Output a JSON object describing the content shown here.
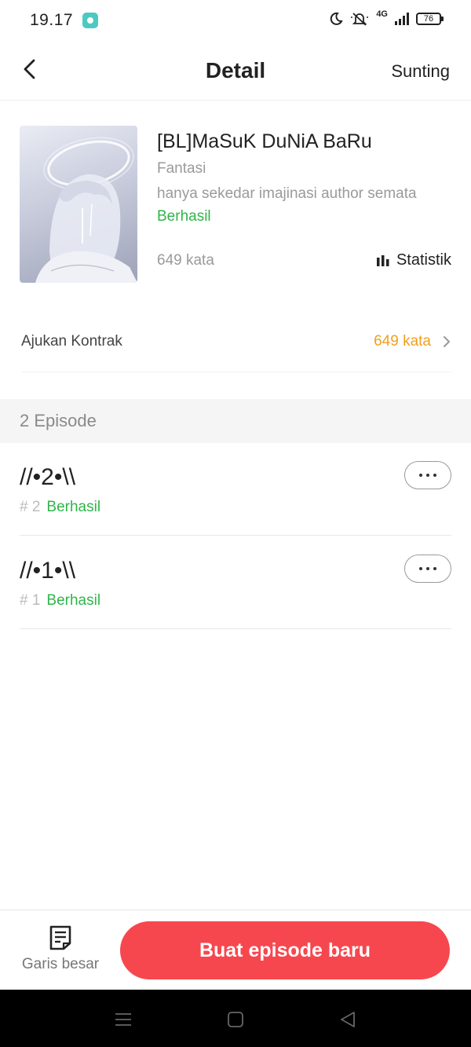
{
  "status_bar": {
    "time": "19.17",
    "battery": "76",
    "network": "4G"
  },
  "header": {
    "title": "Detail",
    "edit_label": "Sunting"
  },
  "book": {
    "title": "[BL]MaSuK DuNiA BaRu",
    "genre": "Fantasi",
    "description": "hanya sekedar imajinasi author semata",
    "status": "Berhasil",
    "word_count": "649 kata",
    "stats_label": "Statistik"
  },
  "contract": {
    "label": "Ajukan Kontrak",
    "value": "649 kata"
  },
  "episodes": {
    "header": "2 Episode",
    "items": [
      {
        "title": "//•2•\\\\",
        "number": "# 2",
        "status": "Berhasil"
      },
      {
        "title": "//•1•\\\\",
        "number": "# 1",
        "status": "Berhasil"
      }
    ]
  },
  "bottom_bar": {
    "outline_label": "Garis besar",
    "create_label": "Buat episode baru"
  },
  "colors": {
    "success": "#2fb54a",
    "accent_orange": "#f0a020",
    "primary_button": "#f7474e"
  },
  "icons": {
    "back": "chevron-left-icon",
    "stats": "bar-chart-icon",
    "chevron": "chevron-right-icon",
    "more": "more-dots-icon",
    "outline": "document-icon",
    "sys_menu": "menu-icon",
    "sys_home": "home-square-icon",
    "sys_back": "back-triangle-icon"
  }
}
